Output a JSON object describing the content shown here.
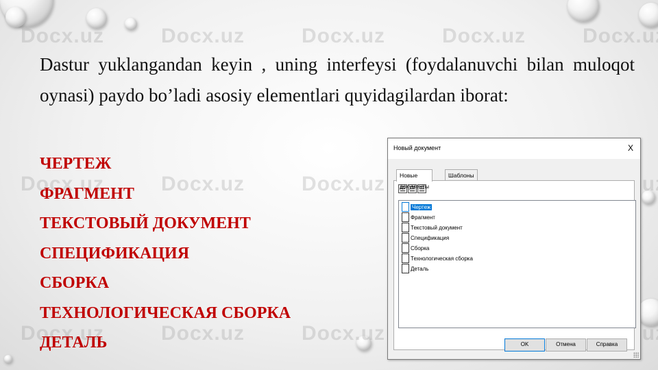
{
  "watermark": "Docx.uz",
  "paragraph": "Dastur yuklangandan keyin , uning interfeysi (foydalanuvchi bilan muloqot oynasi) paydo bo’ladi asosiy elementlari quyidagilardan iborat:",
  "items": [
    "ЧЕРТЕЖ",
    "ФРАГМЕНТ",
    "ТЕКСТОВЫЙ ДОКУМЕНТ",
    "СПЕЦИФИКАЦИЯ",
    "СБОРКА",
    "ТЕХНОЛОГИЧЕСКАЯ СБОРКА",
    "ДЕТАЛЬ"
  ],
  "colors": {
    "accent": "#c00000",
    "selection": "#0078d7"
  },
  "dialog": {
    "title": "Новый документ",
    "close_label": "X",
    "tabs": [
      "Новые документы",
      "Шаблоны"
    ],
    "active_tab": "Новые документы",
    "files": [
      {
        "label": "Чертеж",
        "icon": "drawing-icon",
        "selected": true
      },
      {
        "label": "Фрагмент",
        "icon": "fragment-icon",
        "selected": false
      },
      {
        "label": "Текстовый документ",
        "icon": "text-document-icon",
        "selected": false
      },
      {
        "label": "Спецификация",
        "icon": "specification-icon",
        "selected": false
      },
      {
        "label": "Сборка",
        "icon": "assembly-icon",
        "selected": false
      },
      {
        "label": "Технологическая сборка",
        "icon": "tech-assembly-icon",
        "selected": false
      },
      {
        "label": "Деталь",
        "icon": "part-icon",
        "selected": false
      }
    ],
    "buttons": {
      "ok": "OK",
      "cancel": "Отмена",
      "help": "Справка"
    }
  }
}
